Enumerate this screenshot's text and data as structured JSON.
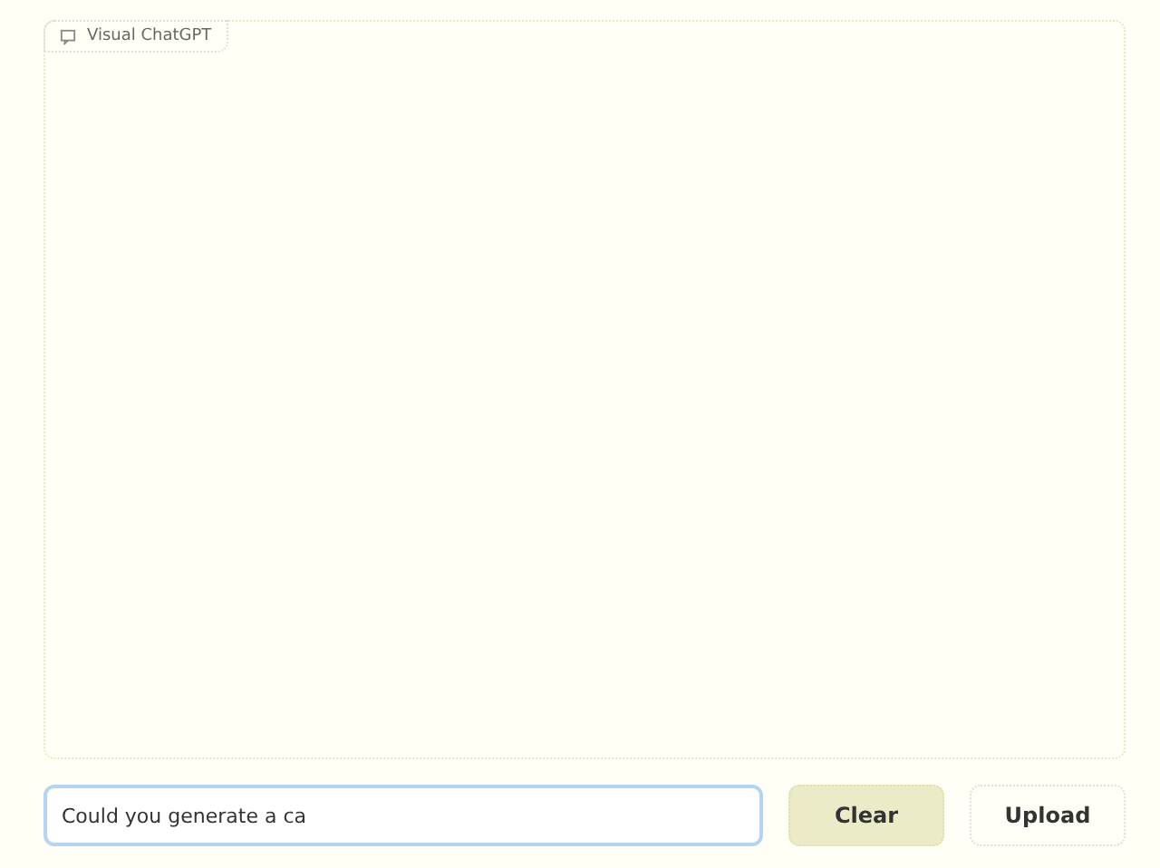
{
  "chatbot": {
    "label": "Visual ChatGPT"
  },
  "input": {
    "value": "Could you generate a ca"
  },
  "buttons": [
    {
      "label": "Clear",
      "kind": "secondary"
    },
    {
      "label": "Upload",
      "kind": "plain"
    }
  ]
}
